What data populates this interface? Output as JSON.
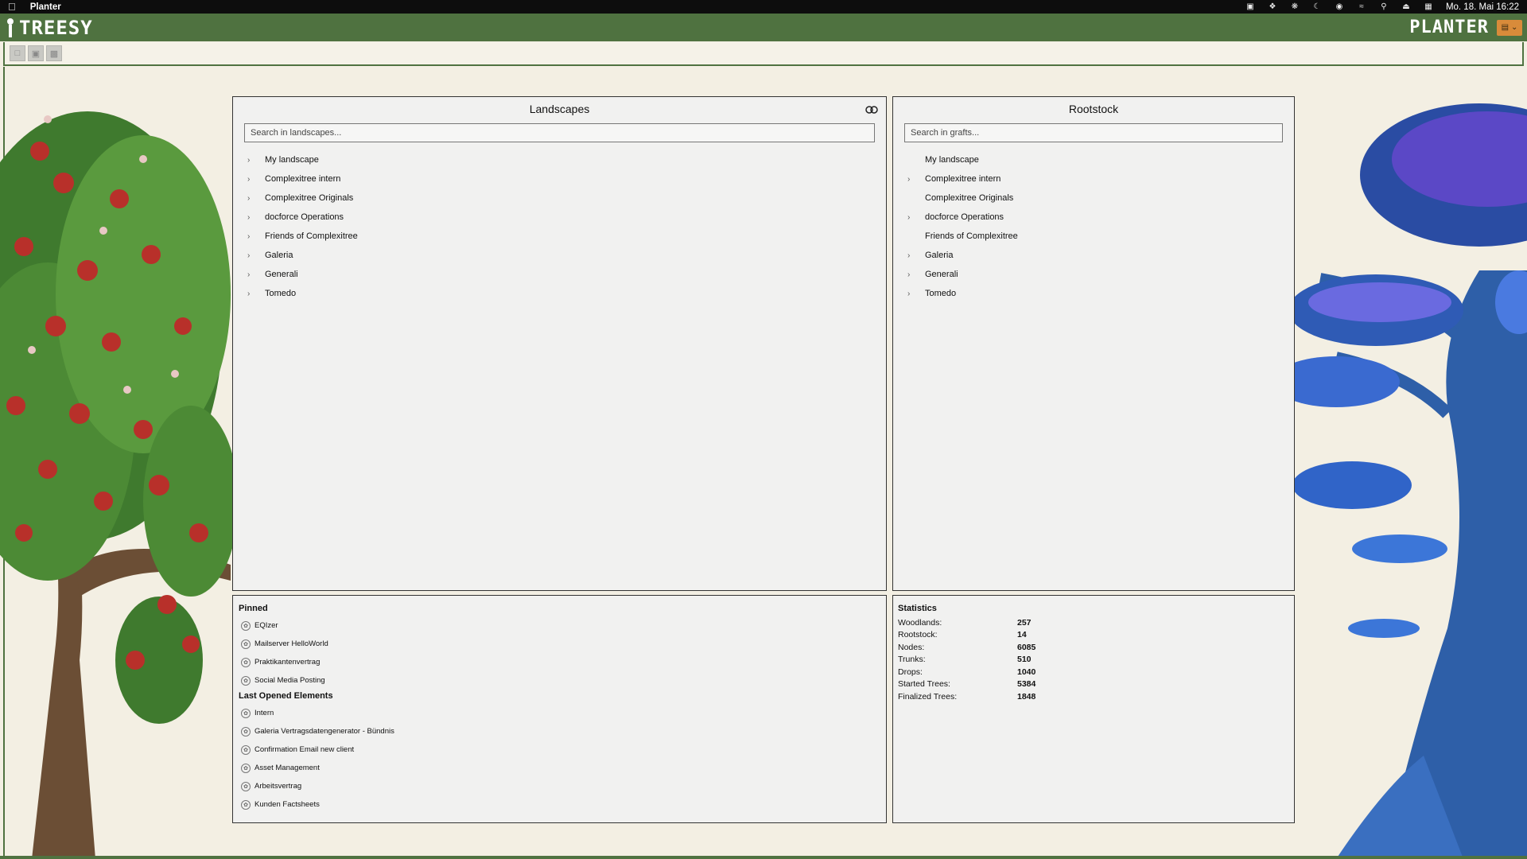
{
  "menubar": {
    "app_name": "Planter",
    "datetime": "Mo. 18. Mai 16:22"
  },
  "header": {
    "logo_text": "TREESY",
    "brand_right": "PLANTER"
  },
  "landscapes": {
    "title": "Landscapes",
    "search_placeholder": "Search in landscapes...",
    "items": [
      {
        "label": "My landscape",
        "expandable": true
      },
      {
        "label": "Complexitree intern",
        "expandable": true
      },
      {
        "label": "Complexitree Originals",
        "expandable": true
      },
      {
        "label": "docforce Operations",
        "expandable": true
      },
      {
        "label": "Friends of Complexitree",
        "expandable": true
      },
      {
        "label": "Galeria",
        "expandable": true
      },
      {
        "label": "Generali",
        "expandable": true
      },
      {
        "label": "Tomedo",
        "expandable": true
      }
    ]
  },
  "rootstock": {
    "title": "Rootstock",
    "search_placeholder": "Search in grafts...",
    "items": [
      {
        "label": "My landscape",
        "expandable": false
      },
      {
        "label": "Complexitree intern",
        "expandable": true
      },
      {
        "label": "Complexitree Originals",
        "expandable": false
      },
      {
        "label": "docforce Operations",
        "expandable": true
      },
      {
        "label": "Friends of Complexitree",
        "expandable": false
      },
      {
        "label": "Galeria",
        "expandable": true
      },
      {
        "label": "Generali",
        "expandable": true
      },
      {
        "label": "Tomedo",
        "expandable": true
      }
    ]
  },
  "pinned": {
    "title": "Pinned",
    "items": [
      "EQIzer",
      "Mailserver HelloWorld",
      "Praktikantenvertrag",
      "Social Media Posting"
    ]
  },
  "last_opened": {
    "title": "Last Opened Elements",
    "items": [
      "Intern",
      "Galeria Vertragsdatengenerator - Bündnis",
      "Confirmation Email new client",
      "Asset Management",
      "Arbeitsvertrag",
      "Kunden Factsheets"
    ]
  },
  "statistics": {
    "title": "Statistics",
    "rows": [
      {
        "label": "Woodlands:",
        "value": "257"
      },
      {
        "label": "Rootstock:",
        "value": "14"
      },
      {
        "label": "Nodes:",
        "value": "6085"
      },
      {
        "label": "Trunks:",
        "value": "510"
      },
      {
        "label": "Drops:",
        "value": "1040"
      },
      {
        "label": "Started Trees:",
        "value": "5384"
      },
      {
        "label": "Finalized Trees:",
        "value": "1848"
      }
    ]
  },
  "colors": {
    "header_green": "#4f7240",
    "page_bg": "#f3efe3",
    "user_button": "#d98b3a"
  }
}
